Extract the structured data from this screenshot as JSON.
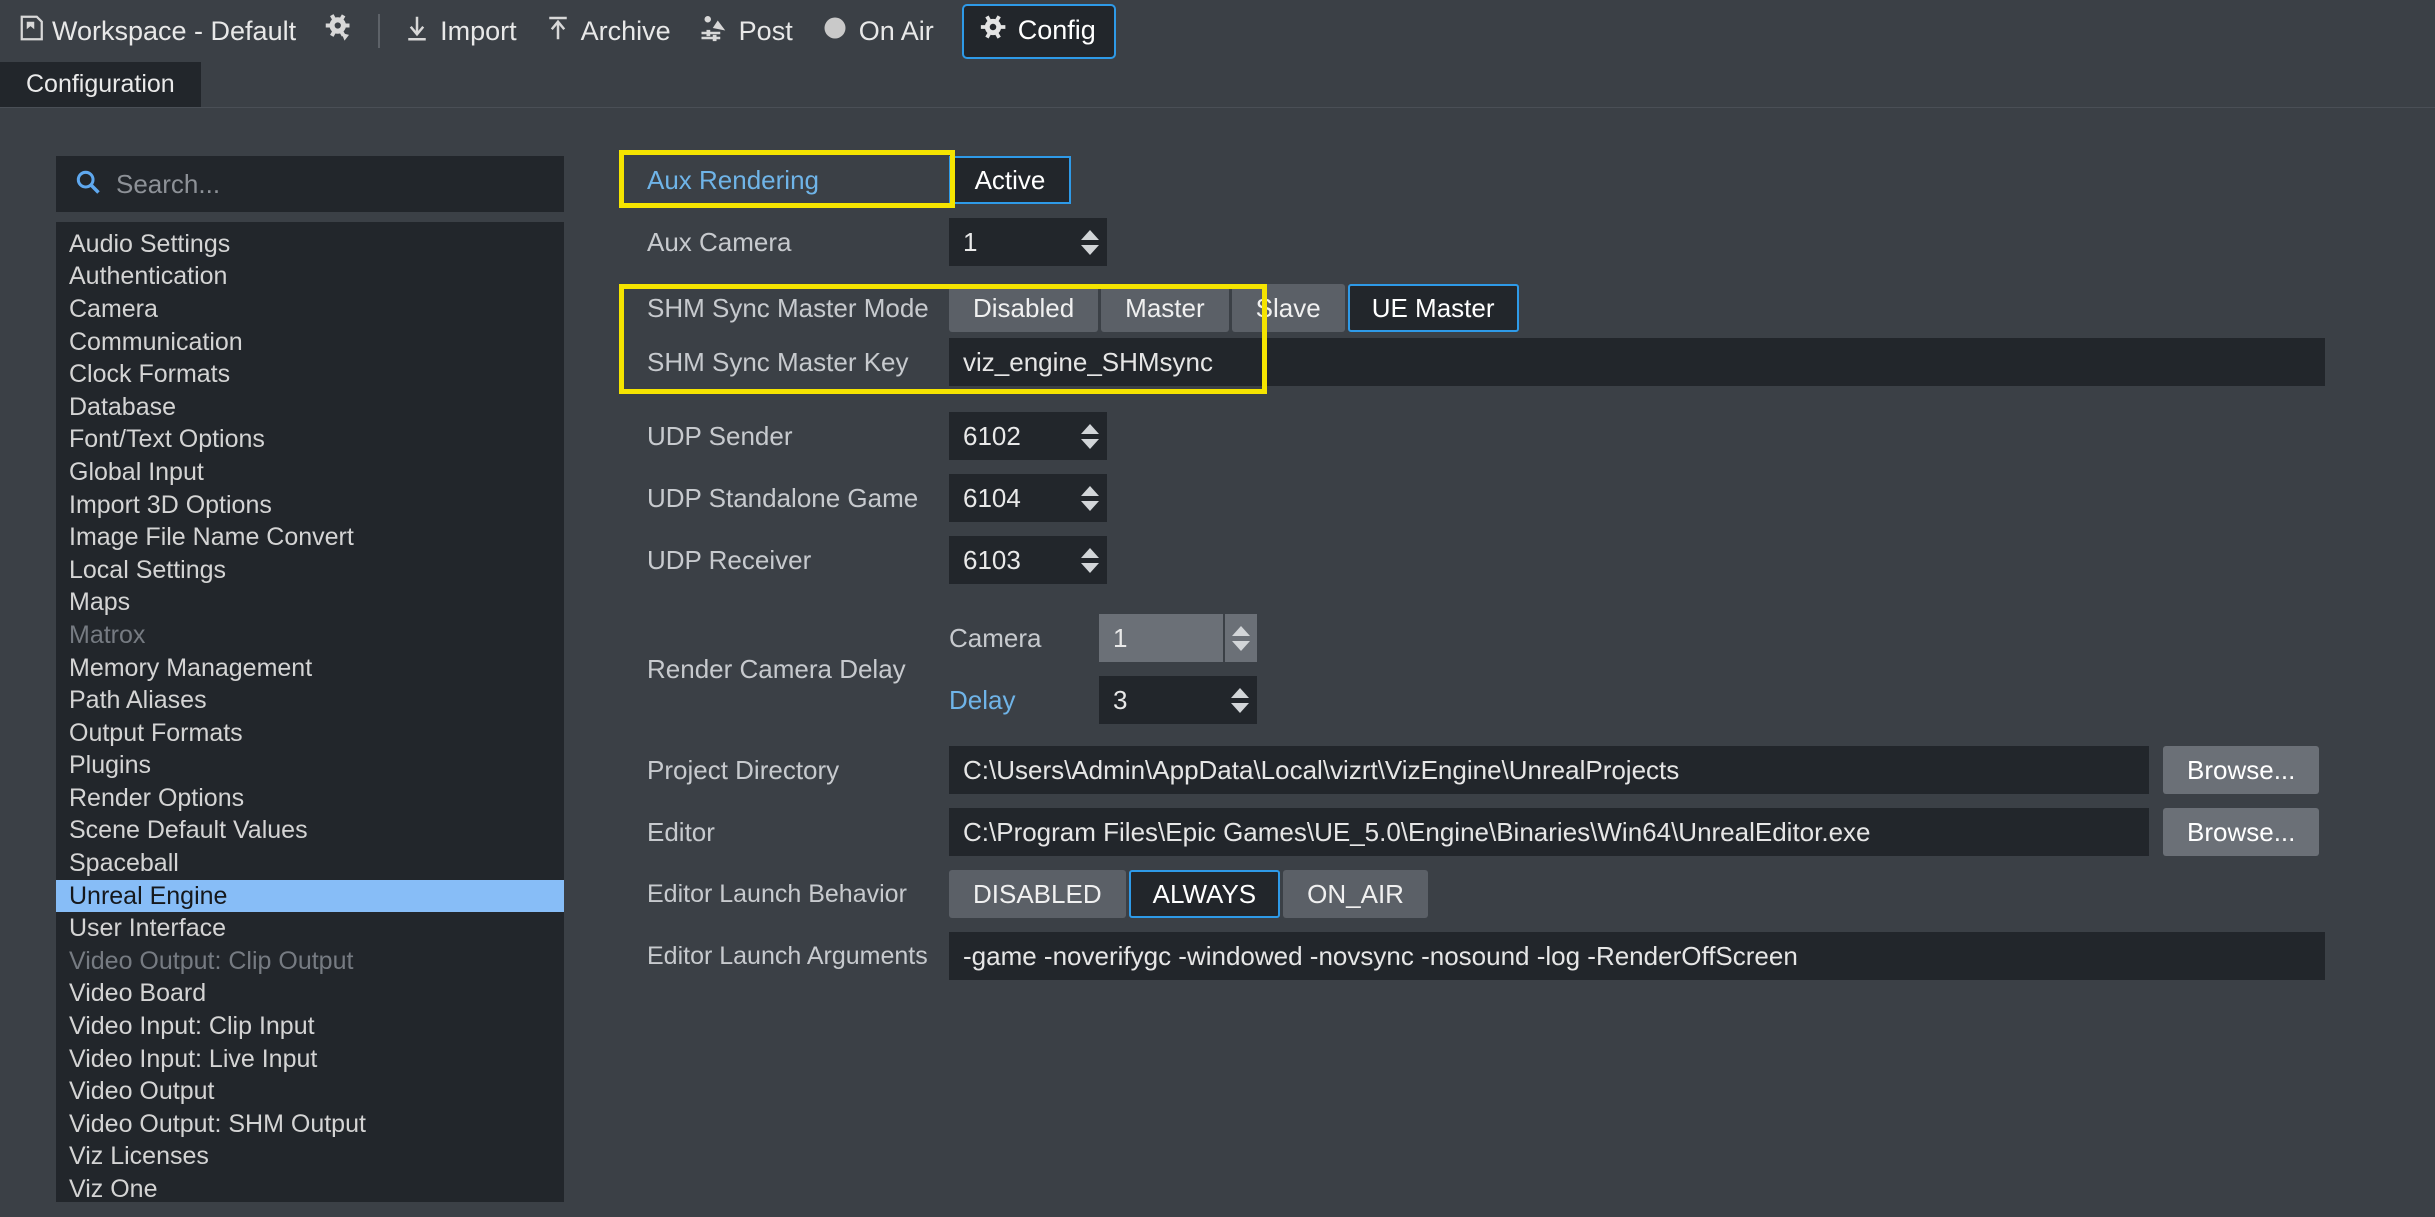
{
  "toolbar": {
    "workspace_label": "Workspace - Default",
    "workspace_icon": "workspace-icon",
    "settings_icon": "gear-settings-icon",
    "import_label": "Import",
    "import_icon": "import-arrow-down-icon",
    "archive_label": "Archive",
    "archive_icon": "archive-arrow-up-icon",
    "post_label": "Post",
    "post_icon": "post-sliders-image-icon",
    "onair_label": "On Air",
    "onair_icon": "onair-circle-icon",
    "config_label": "Config",
    "config_icon": "gear-icon"
  },
  "tabs": [
    {
      "label": "Configuration"
    }
  ],
  "search": {
    "placeholder": "Search...",
    "value": "",
    "icon": "search-icon"
  },
  "sidebar": {
    "items": [
      {
        "label": "Audio Settings",
        "state": "normal"
      },
      {
        "label": "Authentication",
        "state": "normal"
      },
      {
        "label": "Camera",
        "state": "normal"
      },
      {
        "label": "Communication",
        "state": "normal"
      },
      {
        "label": "Clock Formats",
        "state": "normal"
      },
      {
        "label": "Database",
        "state": "normal"
      },
      {
        "label": "Font/Text Options",
        "state": "normal"
      },
      {
        "label": "Global Input",
        "state": "normal"
      },
      {
        "label": "Import 3D Options",
        "state": "normal"
      },
      {
        "label": "Image File Name Convert",
        "state": "normal"
      },
      {
        "label": "Local Settings",
        "state": "normal"
      },
      {
        "label": "Maps",
        "state": "normal"
      },
      {
        "label": "Matrox",
        "state": "disabled"
      },
      {
        "label": "Memory Management",
        "state": "normal"
      },
      {
        "label": "Path Aliases",
        "state": "normal"
      },
      {
        "label": "Output Formats",
        "state": "normal"
      },
      {
        "label": "Plugins",
        "state": "normal"
      },
      {
        "label": "Render Options",
        "state": "normal"
      },
      {
        "label": "Scene Default Values",
        "state": "normal"
      },
      {
        "label": "Spaceball",
        "state": "normal"
      },
      {
        "label": "Unreal Engine",
        "state": "selected"
      },
      {
        "label": "User Interface",
        "state": "normal"
      },
      {
        "label": "Video Output: Clip Output",
        "state": "disabled"
      },
      {
        "label": "Video Board",
        "state": "normal"
      },
      {
        "label": "Video Input: Clip Input",
        "state": "normal"
      },
      {
        "label": "Video Input: Live Input",
        "state": "normal"
      },
      {
        "label": "Video Output",
        "state": "normal"
      },
      {
        "label": "Video Output: SHM Output",
        "state": "normal"
      },
      {
        "label": "Viz Licenses",
        "state": "normal"
      },
      {
        "label": "Viz One",
        "state": "normal"
      }
    ]
  },
  "settings": {
    "aux_rendering": {
      "label": "Aux Rendering",
      "value": "Active"
    },
    "aux_camera": {
      "label": "Aux Camera",
      "value": "1"
    },
    "shm_sync_master_mode": {
      "label": "SHM Sync Master Mode",
      "options": [
        "Disabled",
        "Master",
        "Slave",
        "UE Master"
      ],
      "selected": "UE Master"
    },
    "shm_sync_master_key": {
      "label": "SHM Sync Master Key",
      "value": "viz_engine_SHMsync"
    },
    "udp_sender": {
      "label": "UDP Sender",
      "value": "6102"
    },
    "udp_standalone_game": {
      "label": "UDP Standalone Game",
      "value": "6104"
    },
    "udp_receiver": {
      "label": "UDP Receiver",
      "value": "6103"
    },
    "render_camera_delay": {
      "label": "Render Camera Delay",
      "camera_label": "Camera",
      "camera_value": "1",
      "delay_label": "Delay",
      "delay_value": "3"
    },
    "project_directory": {
      "label": "Project Directory",
      "value": "C:\\Users\\Admin\\AppData\\Local\\vizrt\\VizEngine\\UnrealProjects",
      "browse_label": "Browse..."
    },
    "editor": {
      "label": "Editor",
      "value": "C:\\Program Files\\Epic Games\\UE_5.0\\Engine\\Binaries\\Win64\\UnrealEditor.exe",
      "browse_label": "Browse..."
    },
    "editor_launch_behavior": {
      "label": "Editor Launch Behavior",
      "options": [
        "DISABLED",
        "ALWAYS",
        "ON_AIR"
      ],
      "selected": "ALWAYS"
    },
    "editor_launch_arguments": {
      "label": "Editor Launch Arguments",
      "value": "-game -noverifygc -windowed -novsync -nosound -log -RenderOffScreen"
    }
  },
  "colors": {
    "accent_blue": "#2e9ae8",
    "highlight_yellow": "#f5e400",
    "selection_blue": "#87bdf7",
    "modified_label": "#6fb4e8"
  }
}
